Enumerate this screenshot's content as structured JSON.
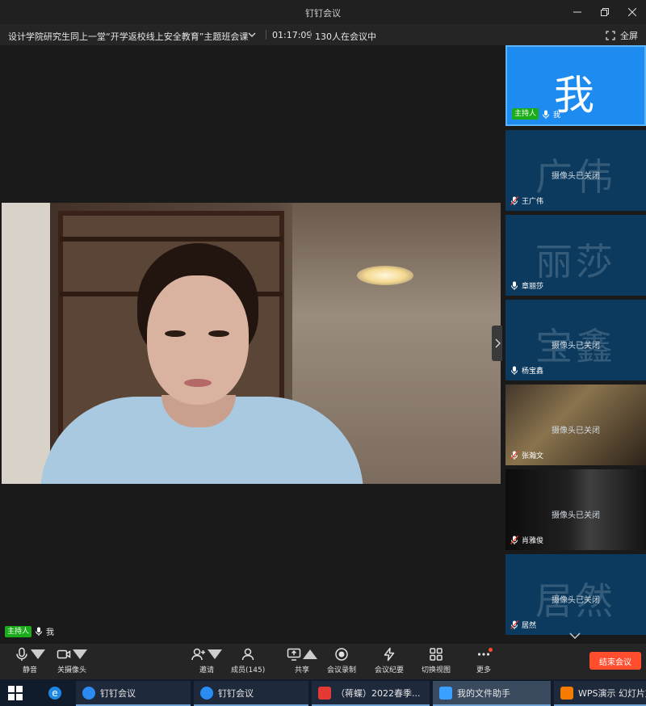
{
  "window": {
    "title": "钉钉会议"
  },
  "meeting": {
    "title": "设计学院研究生同上一堂“开学返校线上安全教育”主题班会课",
    "timer": "01:17:09",
    "participants": "130人在会议中",
    "fullscreen_label": "全屏"
  },
  "self": {
    "host_badge": "主持人",
    "name": "我"
  },
  "sidebar": {
    "camera_off": "摄像头已关闭",
    "tiles": [
      {
        "avatar": "我",
        "name": "我",
        "host": "主持人"
      },
      {
        "avatar": "广伟",
        "name": "王广伟"
      },
      {
        "avatar": "丽莎",
        "name": "章丽莎"
      },
      {
        "avatar": "宝鑫",
        "name": "杨宝鑫"
      },
      {
        "name": "张瀚文"
      },
      {
        "name": "肖雅俊"
      },
      {
        "avatar": "居然",
        "name": "居然"
      }
    ]
  },
  "toolbar": {
    "mute": "静音",
    "camera": "关摄像头",
    "invite": "邀请",
    "members": "成员(145)",
    "share": "共享",
    "record": "会议录制",
    "minutes": "会议纪要",
    "view": "切换视图",
    "more": "更多",
    "end": "结束会议"
  },
  "taskbar": {
    "items": [
      {
        "label": "钉钉会议"
      },
      {
        "label": "钉钉会议"
      },
      {
        "label": "（蒋蝶）2022春季..."
      },
      {
        "label": "我的文件助手"
      },
      {
        "label": "WPS演示 幻灯片放"
      }
    ]
  },
  "colors": {
    "accent": "#1e8bf0",
    "end": "#ff4d2e",
    "host": "#1aad19",
    "taskbar": "#101b2b"
  }
}
